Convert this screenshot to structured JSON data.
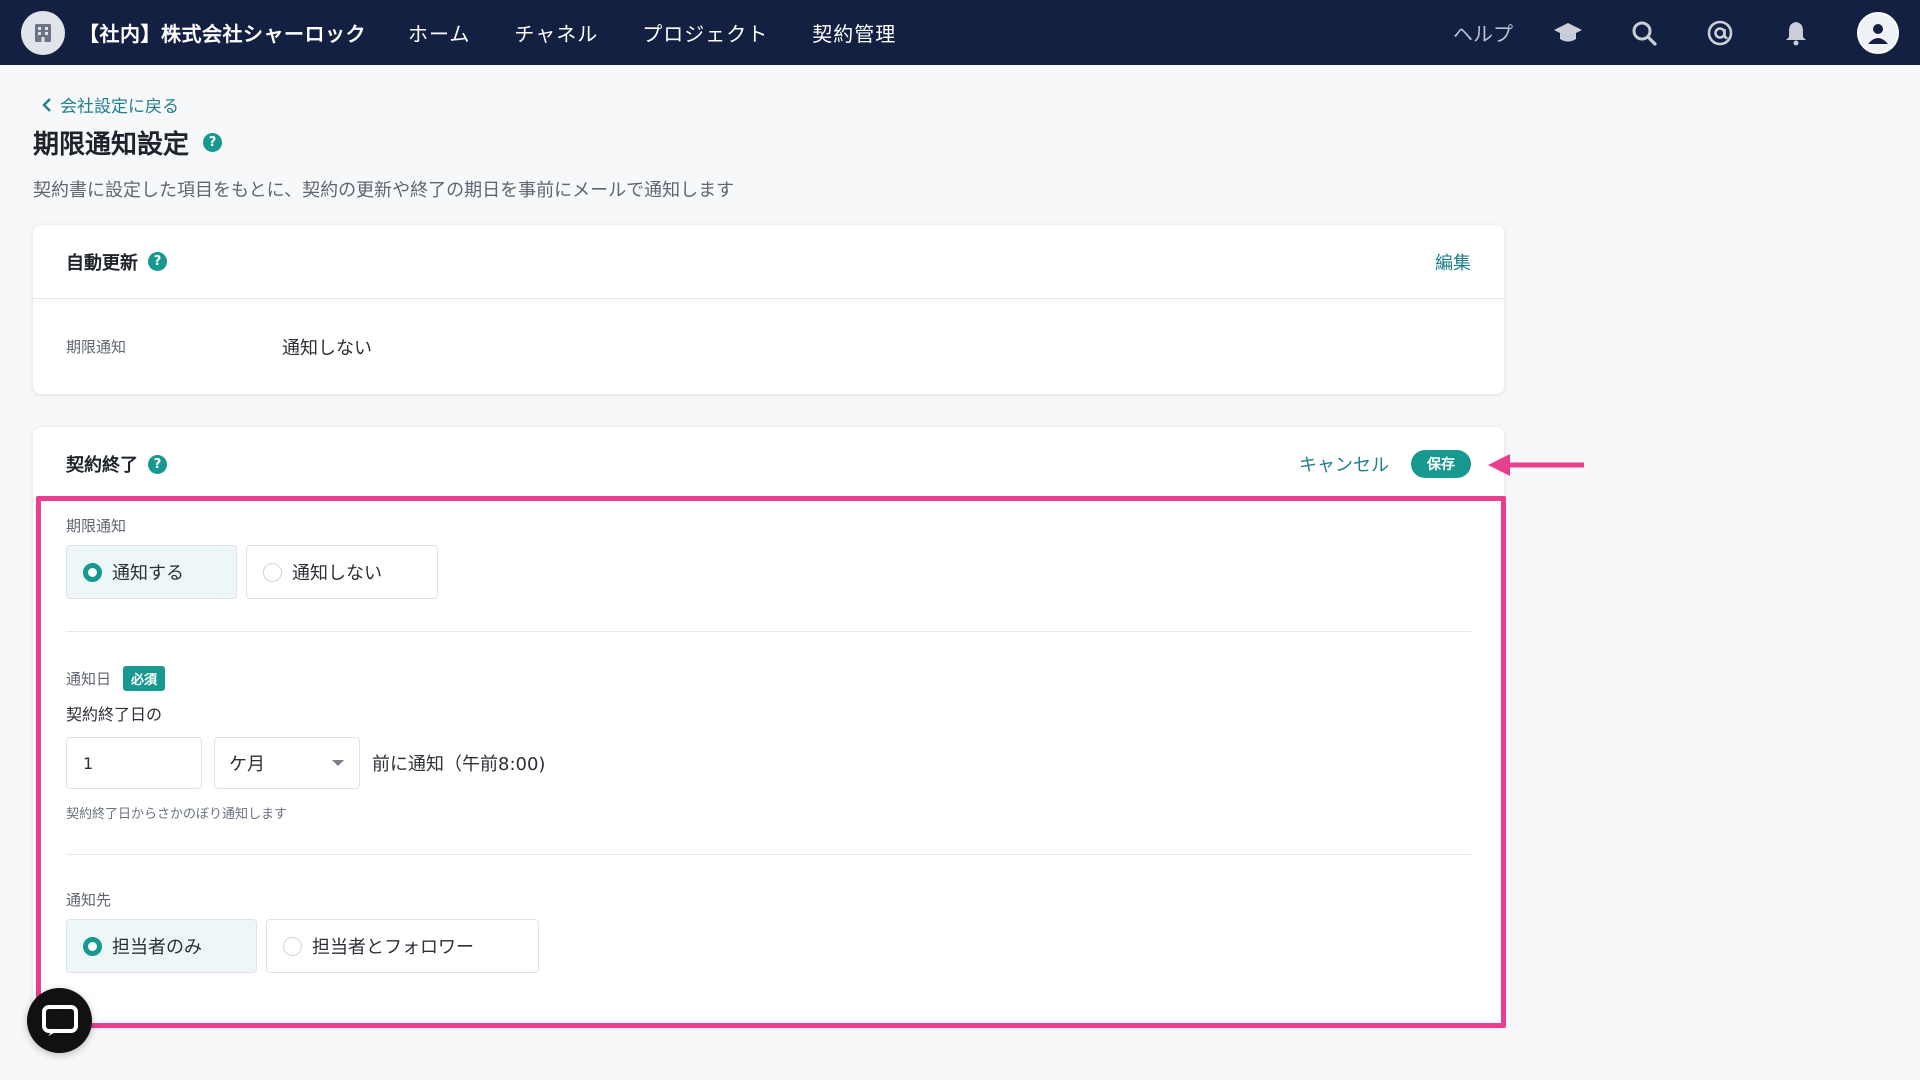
{
  "topbar": {
    "org_name": "【社内】株式会社シャーロック",
    "nav": [
      "ホーム",
      "チャネル",
      "プロジェクト",
      "契約管理"
    ],
    "help": "ヘルプ",
    "icons": [
      "graduation-cap-icon",
      "search-icon",
      "at-mention-icon",
      "bell-icon",
      "user-icon"
    ]
  },
  "page": {
    "back_link": "会社設定に戻る",
    "title": "期限通知設定",
    "help_mark": "?",
    "description": "契約書に設定した項目をもとに、契約の更新や終了の期日を事前にメールで通知します"
  },
  "auto_renew": {
    "title": "自動更新",
    "edit": "編集",
    "row_label": "期限通知",
    "row_value": "通知しない"
  },
  "contract_end": {
    "title": "契約終了",
    "cancel": "キャンセル",
    "save": "保存",
    "notify": {
      "label": "期限通知",
      "options": [
        "通知する",
        "通知しない"
      ],
      "selected": "通知する"
    },
    "notify_date": {
      "label": "通知日",
      "required": "必須",
      "prefix": "契約終了日の",
      "value": "1",
      "unit": "ケ月",
      "suffix": "前に通知（午前8:00)",
      "hint": "契約終了日からさかのぼり通知します"
    },
    "recipients": {
      "label": "通知先",
      "options": [
        "担当者のみ",
        "担当者とフォロワー"
      ],
      "selected": "担当者のみ"
    }
  },
  "colors": {
    "topbar": "#142042",
    "accent": "#17998f",
    "link": "#1f7f8a",
    "annotation": "#e8408f"
  }
}
